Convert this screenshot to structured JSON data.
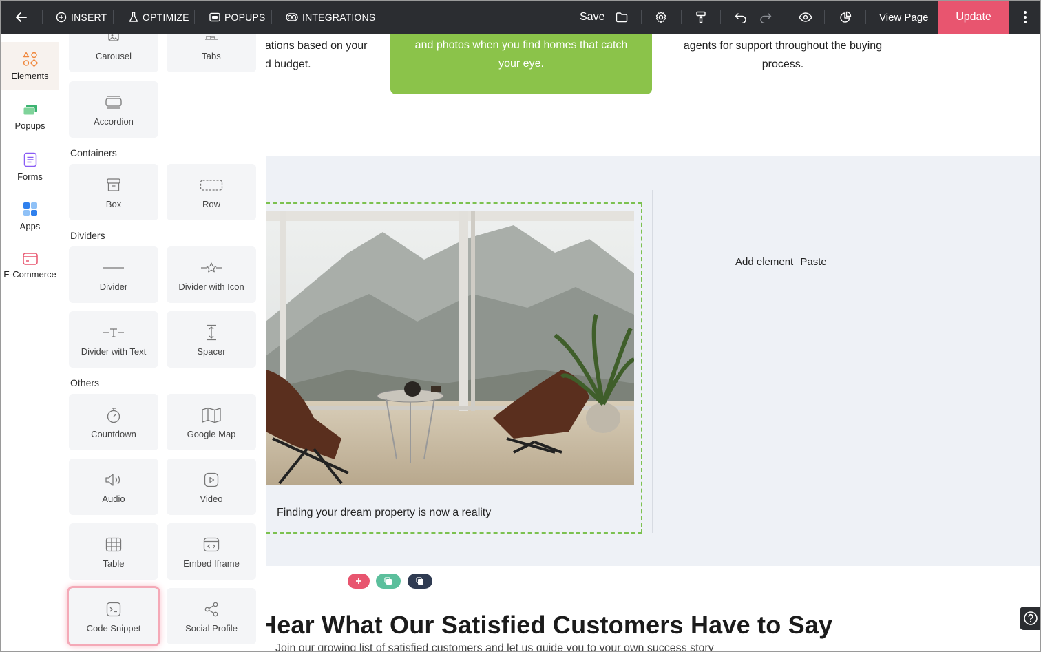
{
  "topbar": {
    "back_icon": "arrow-left-icon",
    "nav": [
      {
        "label": "INSERT",
        "icon": "plus-circle-icon"
      },
      {
        "label": "OPTIMIZE",
        "icon": "flask-icon"
      },
      {
        "label": "POPUPS",
        "icon": "popup-icon"
      },
      {
        "label": "INTEGRATIONS",
        "icon": "toggle-icon"
      }
    ],
    "save_label": "Save",
    "view_page_label": "View Page",
    "update_label": "Update",
    "update_color": "#e8556f",
    "background_color": "#2b2d31"
  },
  "rail": {
    "items": [
      {
        "label": "Elements",
        "icon": "shapes-icon",
        "color": "#f0883e",
        "active": true
      },
      {
        "label": "Popups",
        "icon": "popups-icon",
        "color": "#3cb371"
      },
      {
        "label": "Forms",
        "icon": "form-icon",
        "color": "#8a5cf5"
      },
      {
        "label": "Apps",
        "icon": "apps-grid-icon",
        "color": "#2f80ed"
      },
      {
        "label": "E-Commerce",
        "icon": "card-icon",
        "color": "#e8556f"
      }
    ]
  },
  "panel": {
    "sections": {
      "containers": "Containers",
      "dividers": "Dividers",
      "others": "Others"
    },
    "tiles": {
      "carousel": "Carousel",
      "tabs": "Tabs",
      "accordion": "Accordion",
      "box": "Box",
      "row": "Row",
      "divider": "Divider",
      "divider_icon": "Divider with Icon",
      "divider_text": "Divider with Text",
      "spacer": "Spacer",
      "countdown": "Countdown",
      "google_map": "Google Map",
      "audio": "Audio",
      "video": "Video",
      "table": "Table",
      "embed_iframe": "Embed Iframe",
      "code_snippet": "Code Snippet",
      "social_profile": "Social Profile"
    },
    "highlighted_tile": "Code Snippet"
  },
  "canvas": {
    "col1_line1": "dations based on your",
    "col1_line2": "nd budget.",
    "green_line1": "and photos when you find homes that catch",
    "green_line2": "your eye.",
    "green_color": "#8bc34a",
    "col3_line1": "agents for support throughout the buying",
    "col3_line2": "process.",
    "caption": "Finding your dream property is now a reality",
    "add_element": "Add element",
    "paste": "Paste",
    "heading": "Hear What Our Satisfied Customers Have to Say",
    "subtext": "Join our growing list of satisfied customers and let us guide you to your own success story"
  }
}
